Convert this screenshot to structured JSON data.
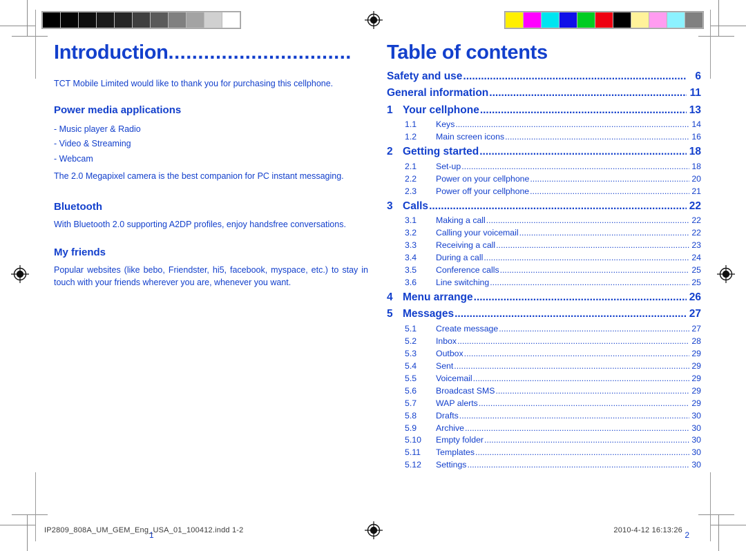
{
  "document": {
    "kind": "print-proof-spread",
    "accent_color": "#1340cc",
    "ink_color": "#3a3a3a"
  },
  "calibration": {
    "grayscale_bar": {
      "name": "grayscale-step-wedge",
      "patches": [
        "#000000",
        "#050505",
        "#0e0e0e",
        "#1a1a1a",
        "#262626",
        "#404040",
        "#5a5a5a",
        "#808080",
        "#a3a3a3",
        "#d0d0d0",
        "#ffffff"
      ]
    },
    "color_bar": {
      "name": "process-color-bar",
      "patches": [
        "#ffef00",
        "#ff00ff",
        "#00e5f0",
        "#1010e8",
        "#00cc22",
        "#ee0011",
        "#000000",
        "#fff29a",
        "#ff9cf0",
        "#8cf2ff",
        "#808080"
      ]
    }
  },
  "left_page": {
    "title": "Introduction",
    "title_dots": "...............................",
    "intro": "TCT Mobile Limited would like to thank you for purchasing this cellphone.",
    "sections": [
      {
        "heading": "Power media applications",
        "bullets": [
          "- Music player & Radio",
          "- Video & Streaming",
          "- Webcam"
        ],
        "paragraph": "The 2.0 Megapixel camera is the best companion for PC instant messaging."
      },
      {
        "heading": "Bluetooth",
        "bullets": [],
        "paragraph": "With Bluetooth 2.0 supporting A2DP profiles, enjoy handsfree conversations."
      },
      {
        "heading": "My friends",
        "bullets": [],
        "paragraph": "Popular websites (like bebo, Friendster, hi5, facebook, myspace, etc.) to stay in touch with your friends wherever you are, whenever you want."
      }
    ],
    "folio": "1"
  },
  "right_page": {
    "title": "Table of contents",
    "toc": [
      {
        "level": "front",
        "num": "",
        "label": "Safety and use",
        "page": "6"
      },
      {
        "level": "front",
        "num": "",
        "label": "General information ",
        "page": "11"
      },
      {
        "level": "1",
        "num": "1",
        "label": "Your cellphone",
        "page": "13"
      },
      {
        "level": "2",
        "num": "1.1",
        "label": "Keys",
        "page": "14"
      },
      {
        "level": "2",
        "num": "1.2",
        "label": "Main screen icons",
        "page": "16"
      },
      {
        "level": "1",
        "num": "2",
        "label": "Getting started",
        "page": "18"
      },
      {
        "level": "2",
        "num": "2.1",
        "label": "Set-up ",
        "page": "18"
      },
      {
        "level": "2",
        "num": "2.2",
        "label": "Power on your cellphone",
        "page": "20"
      },
      {
        "level": "2",
        "num": "2.3",
        "label": "Power off your cellphone",
        "page": "21"
      },
      {
        "level": "1",
        "num": "3",
        "label": "Calls ",
        "page": "22"
      },
      {
        "level": "2",
        "num": "3.1",
        "label": "Making a call",
        "page": "22"
      },
      {
        "level": "2",
        "num": "3.2",
        "label": "Calling your voicemail ",
        "page": "22"
      },
      {
        "level": "2",
        "num": "3.3",
        "label": "Receiving a call ",
        "page": "23"
      },
      {
        "level": "2",
        "num": "3.4",
        "label": "During a call",
        "page": "24"
      },
      {
        "level": "2",
        "num": "3.5",
        "label": "Conference calls ",
        "page": "25"
      },
      {
        "level": "2",
        "num": "3.6",
        "label": "Line switching",
        "page": "25"
      },
      {
        "level": "1",
        "num": "4",
        "label": "Menu arrange",
        "page": "26"
      },
      {
        "level": "1",
        "num": "5",
        "label": "Messages",
        "page": "27"
      },
      {
        "level": "2",
        "num": "5.1",
        "label": "Create message ",
        "page": "27"
      },
      {
        "level": "2",
        "num": "5.2",
        "label": "Inbox",
        "page": "28"
      },
      {
        "level": "2",
        "num": "5.3",
        "label": "Outbox",
        "page": "29"
      },
      {
        "level": "2",
        "num": "5.4",
        "label": "Sent",
        "page": "29"
      },
      {
        "level": "2",
        "num": "5.5",
        "label": "Voicemail",
        "page": "29"
      },
      {
        "level": "2",
        "num": "5.6",
        "label": "Broadcast SMS",
        "page": "29"
      },
      {
        "level": "2",
        "num": "5.7",
        "label": "WAP alerts",
        "page": "29"
      },
      {
        "level": "2",
        "num": "5.8",
        "label": "Drafts",
        "page": "30"
      },
      {
        "level": "2",
        "num": "5.9",
        "label": "Archive ",
        "page": "30"
      },
      {
        "level": "2",
        "num": "5.10",
        "label": "Empty folder ",
        "page": "30"
      },
      {
        "level": "2",
        "num": "5.11",
        "label": "Templates",
        "page": "30"
      },
      {
        "level": "2",
        "num": "5.12",
        "label": "Settings",
        "page": "30"
      }
    ],
    "folio": "2"
  },
  "footer": {
    "filename": "IP2809_808A_UM_GEM_Eng_USA_01_100412.indd   1-2",
    "timestamp": "2010-4-12   16:13:26"
  },
  "leader": {
    "dots": "................................................................................................................................................................................"
  }
}
